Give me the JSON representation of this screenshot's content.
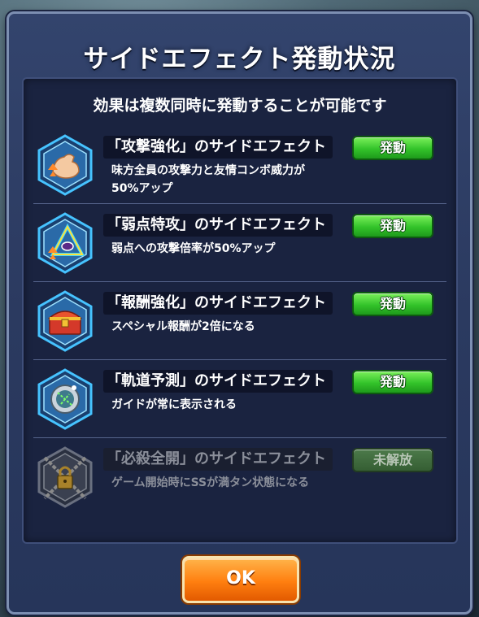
{
  "dialog": {
    "title": "サイドエフェクト発動状況",
    "subtitle": "効果は複数同時に発動することが可能です",
    "ok_label": "OK"
  },
  "effects": [
    {
      "name": "「攻撃強化」のサイドエフェクト",
      "desc_line1": "味方全員の攻撃力と友情コンボ威力が",
      "desc_line2": "50%アップ",
      "status": "発動",
      "icon": "flexed-arm-icon"
    },
    {
      "name": "「弱点特攻」のサイドエフェクト",
      "desc_line1": "弱点への攻撃倍率が50%アップ",
      "desc_line2": "",
      "status": "発動",
      "icon": "weak-point-triangle-icon"
    },
    {
      "name": "「報酬強化」のサイドエフェクト",
      "desc_line1": "スペシャル報酬が2倍になる",
      "desc_line2": "",
      "status": "発動",
      "icon": "treasure-chest-icon"
    },
    {
      "name": "「軌道予測」のサイドエフェクト",
      "desc_line1": "ガイドが常に表示される",
      "desc_line2": "",
      "status": "発動",
      "icon": "trajectory-ball-icon"
    },
    {
      "name": "「必殺全開」のサイドエフェクト",
      "desc_line1": "ゲーム開始時にSSが満タン状態になる",
      "desc_line2": "",
      "status": "未解放",
      "icon": "locked-chains-icon"
    }
  ],
  "colors": {
    "active_badge": "#33c32a",
    "locked_badge": "#355e33",
    "ok_button": "#ff7f10",
    "dialog_bg": "#2b3a60"
  }
}
